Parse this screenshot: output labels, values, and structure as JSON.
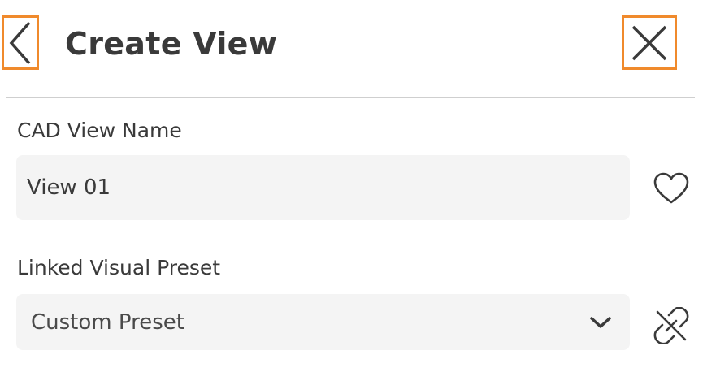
{
  "header": {
    "title": "Create View",
    "back_icon": "chevron-left-icon",
    "close_icon": "close-icon",
    "highlight_color": "#f08a2c"
  },
  "form": {
    "name_field": {
      "label": "CAD View Name",
      "value": "View 01",
      "favorite_icon": "heart-icon"
    },
    "preset_field": {
      "label": "Linked Visual Preset",
      "selected": "Custom Preset",
      "dropdown_icon": "chevron-down-icon",
      "unlink_icon": "unlink-icon"
    }
  },
  "colors": {
    "text": "#3a3a3a",
    "field_background": "#f4f4f4",
    "divider": "#cfcfcf"
  }
}
